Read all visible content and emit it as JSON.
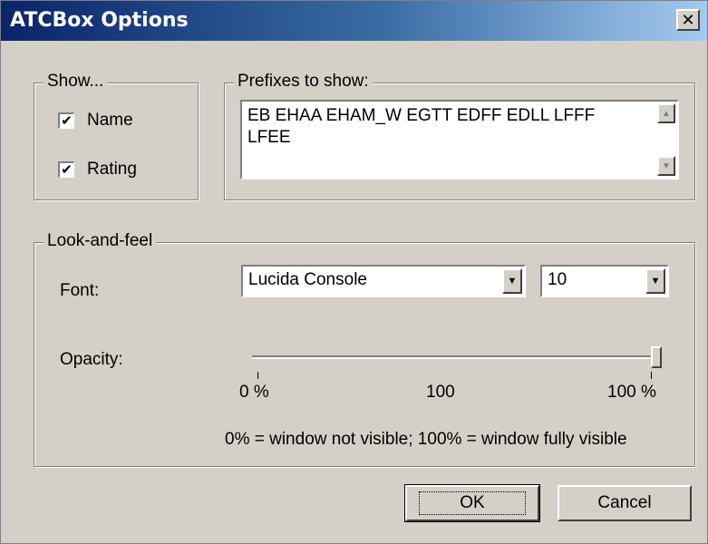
{
  "window": {
    "title": "ATCBox Options",
    "close_glyph": "✕"
  },
  "show_group": {
    "legend": "Show...",
    "name": {
      "label": "Name",
      "checked": true
    },
    "rating": {
      "label": "Rating",
      "checked": true
    },
    "check_glyph": "✔"
  },
  "prefixes_group": {
    "legend": "Prefixes to show:",
    "value": "EB EHAA EHAM_W EGTT EDFF EDLL LFFF LFEE"
  },
  "look_group": {
    "legend": "Look-and-feel",
    "font_label": "Font:",
    "font_value": "Lucida Console",
    "size_value": "10",
    "opacity_label": "Opacity:",
    "opacity_value": 1.0,
    "ticks": [
      "0 %",
      "100",
      "100 %"
    ],
    "note": "0% = window not visible; 100% = window fully visible"
  },
  "buttons": {
    "ok": "OK",
    "cancel": "Cancel"
  },
  "icons": {
    "close": "close-icon",
    "dropdown": "chevron-down-icon",
    "scroll_up": "scroll-up-icon",
    "scroll_down": "scroll-down-icon"
  }
}
